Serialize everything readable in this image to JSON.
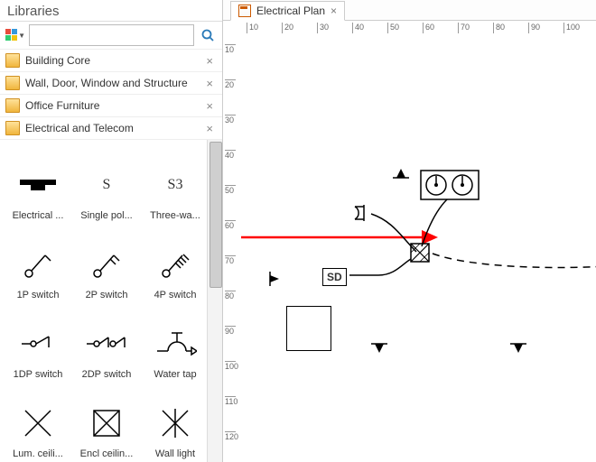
{
  "sidebar": {
    "title": "Libraries",
    "search_placeholder": "",
    "categories": [
      {
        "label": "Building Core"
      },
      {
        "label": "Wall, Door, Window and Structure"
      },
      {
        "label": "Office Furniture"
      },
      {
        "label": "Electrical and Telecom"
      }
    ],
    "shapes": [
      {
        "name": "electrical-service",
        "label": "Electrical ..."
      },
      {
        "name": "single-pole",
        "label": "Single pol...",
        "glyph": "S"
      },
      {
        "name": "three-way",
        "label": "Three-wa...",
        "glyph": "S3"
      },
      {
        "name": "1p-switch",
        "label": "1P switch"
      },
      {
        "name": "2p-switch",
        "label": "2P switch"
      },
      {
        "name": "4p-switch",
        "label": "4P switch"
      },
      {
        "name": "1dp-switch",
        "label": "1DP switch"
      },
      {
        "name": "2dp-switch",
        "label": "2DP switch"
      },
      {
        "name": "water-tap",
        "label": "Water tap"
      },
      {
        "name": "lum-ceiling",
        "label": "Lum. ceili..."
      },
      {
        "name": "encl-ceiling",
        "label": "Encl ceilin..."
      },
      {
        "name": "wall-light",
        "label": "Wall light"
      }
    ]
  },
  "document": {
    "tab_label": "Electrical Plan",
    "ruler_h_ticks": [
      10,
      20,
      30,
      40,
      50,
      60,
      70,
      80,
      90,
      100
    ],
    "ruler_v_ticks": [
      10,
      20,
      30,
      40,
      50,
      60,
      70,
      80,
      90,
      100,
      110,
      120
    ],
    "sd_label": "SD"
  }
}
